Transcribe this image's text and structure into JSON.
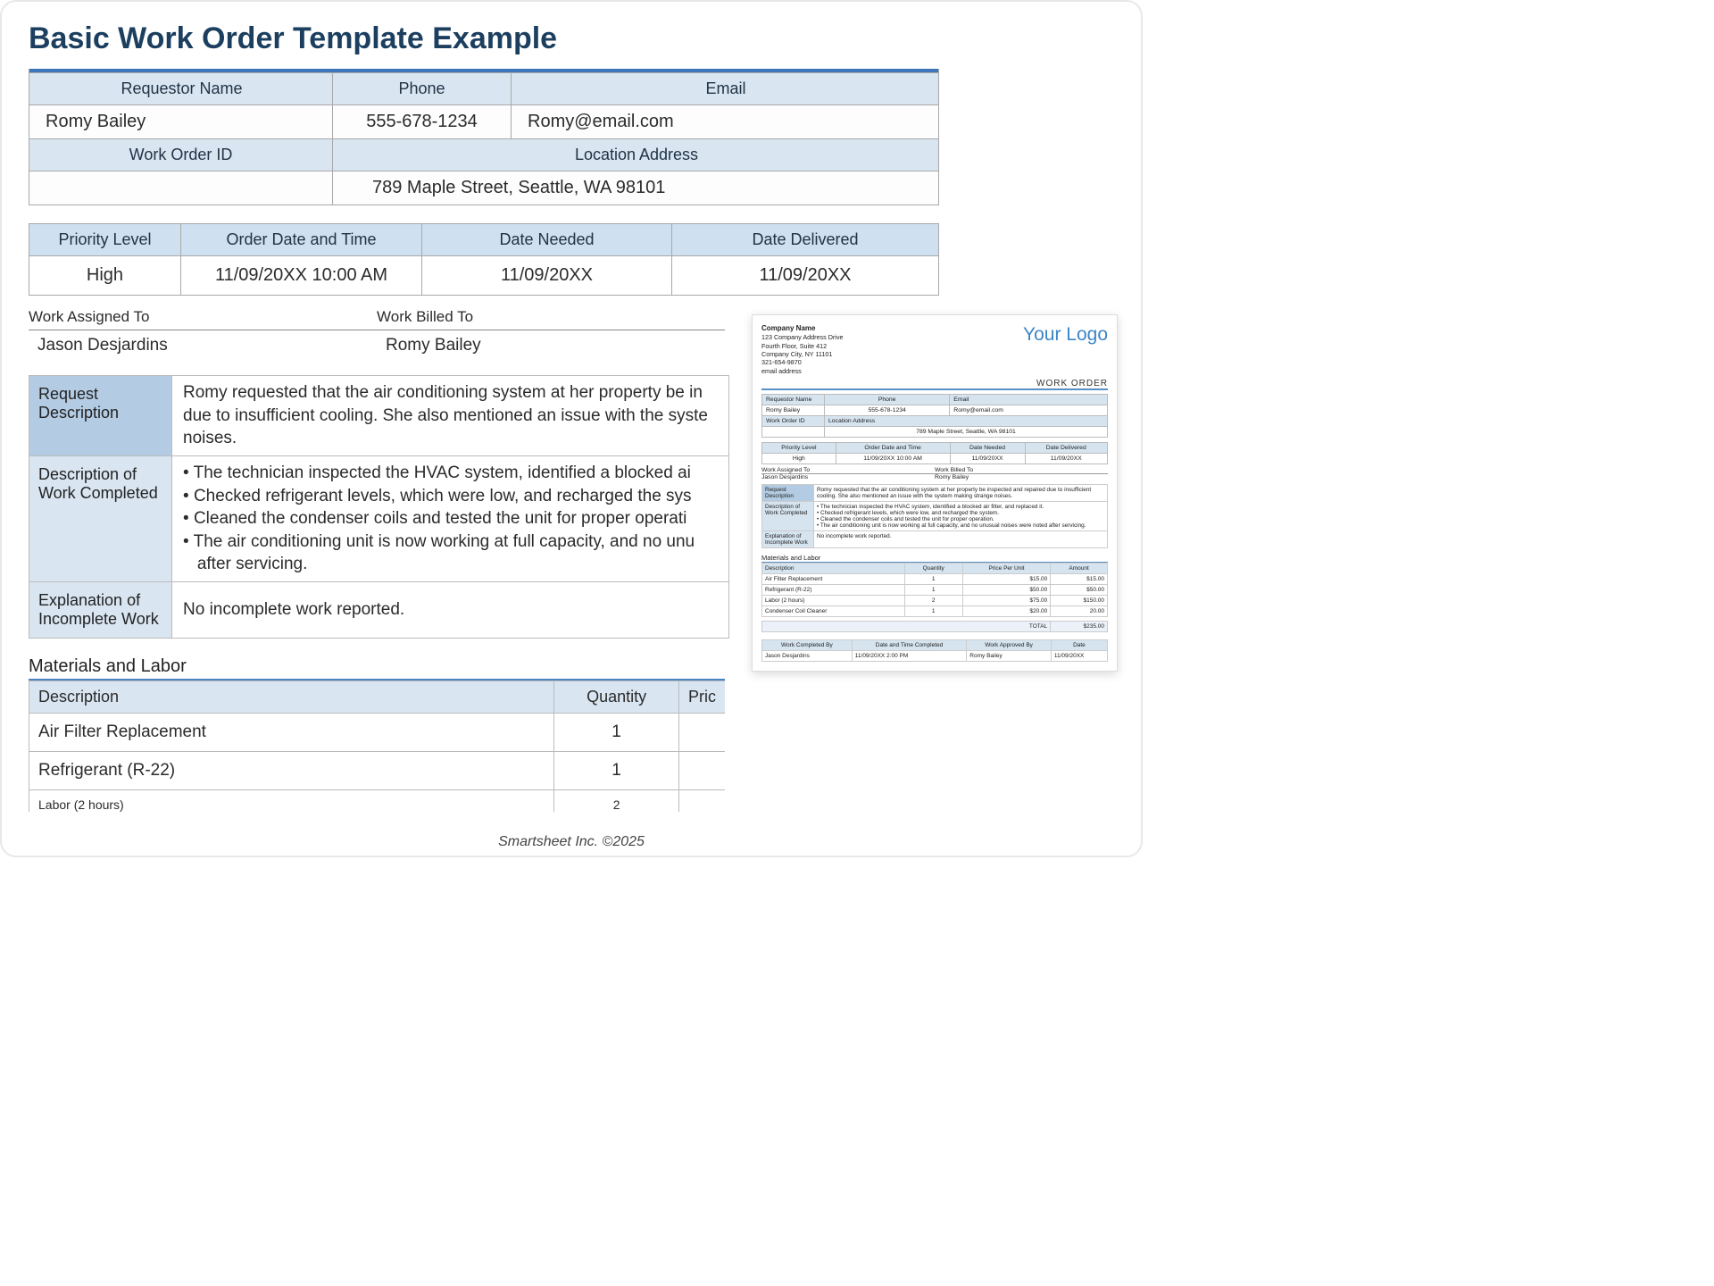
{
  "title": "Basic Work Order Template Example",
  "footer": "Smartsheet Inc. ©2025",
  "section1": {
    "headers": {
      "requestor": "Requestor Name",
      "phone": "Phone",
      "email": "Email",
      "work_order_id": "Work Order ID",
      "location": "Location Address"
    },
    "values": {
      "requestor": "Romy Bailey",
      "phone": "555-678-1234",
      "email": "Romy@email.com",
      "work_order_id": "",
      "location": "789 Maple Street, Seattle, WA 98101"
    }
  },
  "section2": {
    "headers": {
      "priority": "Priority Level",
      "order_date": "Order Date and Time",
      "date_needed": "Date Needed",
      "date_delivered": "Date Delivered"
    },
    "values": {
      "priority": "High",
      "order_date": "11/09/20XX 10:00 AM",
      "date_needed": "11/09/20XX",
      "date_delivered": "11/09/20XX"
    }
  },
  "assign": {
    "assigned_label": "Work Assigned To",
    "assigned_value": "Jason Desjardins",
    "billed_label": "Work Billed To",
    "billed_value": "Romy Bailey"
  },
  "desc": {
    "request_label": "Request Description",
    "request_text_visible": "Romy requested that the air conditioning system at her property be in\ndue to insufficient cooling. She also mentioned an issue with the syste\nnoises.",
    "completed_label": "Description of Work Completed",
    "completed_bullets_visible": [
      "The technician inspected the HVAC system, identified a blocked ai",
      "Checked refrigerant levels, which were low, and recharged the sys",
      "Cleaned the condenser coils and tested the unit for proper operati",
      "The air conditioning unit is now working at full capacity, and no unu after servicing."
    ],
    "incomplete_label": "Explanation of Incomplete Work",
    "incomplete_text": "No incomplete work reported."
  },
  "materials": {
    "title": "Materials and Labor",
    "headers": {
      "desc": "Description",
      "qty": "Quantity",
      "price": "Pric"
    },
    "rows": [
      {
        "desc": "Air Filter Replacement",
        "qty": "1",
        "price": ""
      },
      {
        "desc": "Refrigerant (R-22)",
        "qty": "1",
        "price": ""
      }
    ],
    "cut_row": {
      "desc": "Labor (2 hours)",
      "qty": "2"
    }
  },
  "thumb": {
    "company": {
      "name": "Company Name",
      "lines": [
        "123 Company Address Drive",
        "Fourth Floor, Suite 412",
        "Company City, NY 11101",
        "321-654-9870",
        "email address"
      ]
    },
    "logo": "Your Logo",
    "wo": "WORK ORDER",
    "request_full": "Romy requested that the air conditioning system at her property be inspected and repaired due to insufficient cooling. She also mentioned an issue with the system making strange noises.",
    "completed_full": [
      "The technician inspected the HVAC system, identified a blocked air filter, and replaced it.",
      "Checked refrigerant levels, which were low, and recharged the system.",
      "Cleaned the condenser coils and tested the unit for proper operation.",
      "The air conditioning unit is now working at full capacity, and no unusual noises were noted after servicing."
    ],
    "mat_rows": [
      {
        "d": "Air Filter Replacement",
        "q": "1",
        "p": "$15.00",
        "a": "$15.00"
      },
      {
        "d": "Refrigerant (R-22)",
        "q": "1",
        "p": "$50.00",
        "a": "$50.00"
      },
      {
        "d": "Labor (2 hours)",
        "q": "2",
        "p": "$75.00",
        "a": "$150.00"
      },
      {
        "d": "Condenser Coil Cleaner",
        "q": "1",
        "p": "$20.00",
        "a": "20.00"
      }
    ],
    "mat_headers": {
      "d": "Description",
      "q": "Quantity",
      "p": "Price Per Unit",
      "a": "Amount"
    },
    "total_label": "TOTAL",
    "total_value": "$235.00",
    "sign": {
      "h": [
        "Work Completed By",
        "Date and Time Completed",
        "Work Approved By",
        "Date"
      ],
      "v": [
        "Jason Desjardins",
        "11/09/20XX 2:00 PM",
        "Romy Bailey",
        "11/09/20XX"
      ]
    }
  }
}
